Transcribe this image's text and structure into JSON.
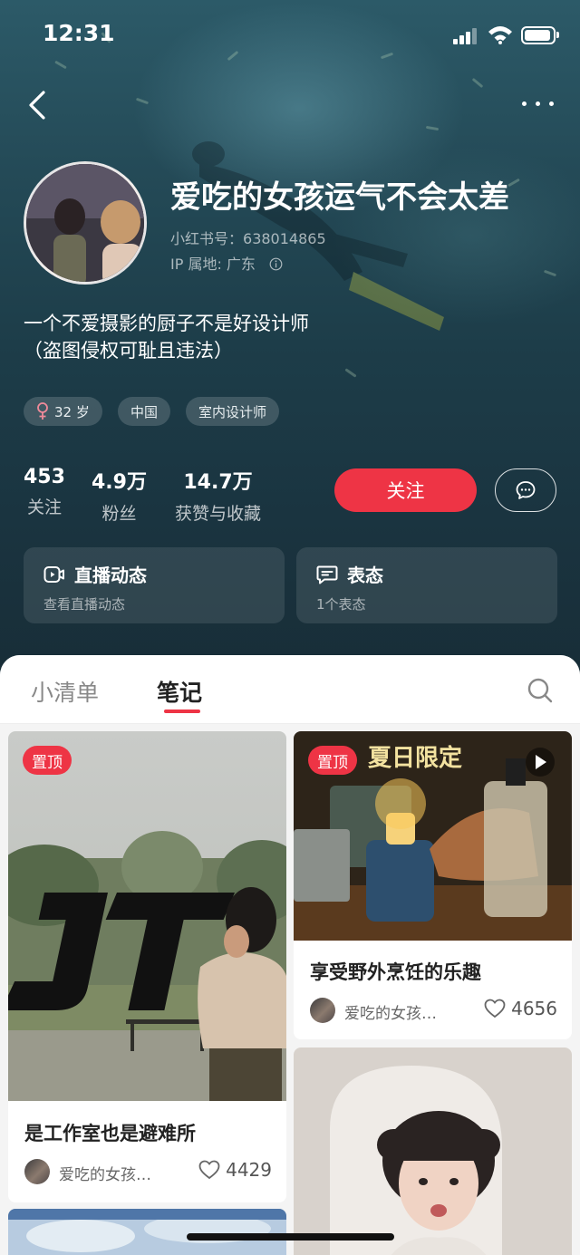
{
  "status": {
    "time": "12:31"
  },
  "profile": {
    "name": "爱吃的女孩运气不会太差",
    "id_label": "小红书号：",
    "id_value": "638014865",
    "ip_label": "IP 属地: 广东",
    "bio_line1": "一个不爱摄影的厨子不是好设计师",
    "bio_line2": "（盗图侵权可耻且违法）",
    "tags": [
      "32 岁",
      "中国",
      "室内设计师"
    ]
  },
  "stats": [
    {
      "value": "453",
      "label": "关注"
    },
    {
      "value": "4.9万",
      "label": "粉丝"
    },
    {
      "value": "14.7万",
      "label": "获赞与收藏"
    }
  ],
  "actions": {
    "follow_label": "关注"
  },
  "cards": [
    {
      "title": "直播动态",
      "subtitle": "查看直播动态"
    },
    {
      "title": "表态",
      "subtitle": "1个表态"
    }
  ],
  "tabs": [
    {
      "label": "小清单",
      "active": false
    },
    {
      "label": "笔记",
      "active": true
    }
  ],
  "notes": [
    {
      "pin": "置顶",
      "title": "是工作室也是避难所",
      "author": "爱吃的女孩…",
      "likes": "4429",
      "logo_text": "JT"
    },
    {
      "pin": "置顶",
      "title": "享受野外烹饪的乐趣",
      "author": "爱吃的女孩…",
      "likes": "4656",
      "overlay_text": "夏日限定"
    }
  ],
  "colors": {
    "accent": "#ee3445",
    "header_bg": "#1d3d49"
  }
}
